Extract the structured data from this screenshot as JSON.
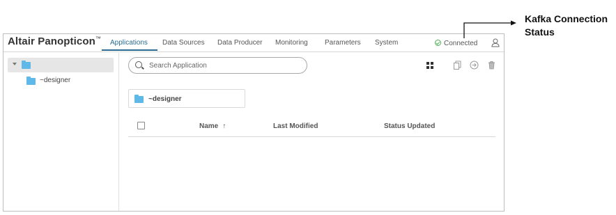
{
  "brand": {
    "name": "Altair Panopticon",
    "trademark": "™"
  },
  "nav": {
    "tabs": [
      {
        "label": "Applications",
        "active": true
      },
      {
        "label": "Data Sources"
      },
      {
        "label": "Data Producer"
      },
      {
        "label": "Monitoring"
      },
      {
        "label": "Parameters"
      },
      {
        "label": "System"
      }
    ],
    "status": "Connected"
  },
  "sidebar": {
    "child_label": "~designer"
  },
  "search": {
    "placeholder": "Search Application"
  },
  "folder_card": {
    "label": "~designer"
  },
  "table": {
    "columns": [
      "Name",
      "Last Modified",
      "Status Updated"
    ],
    "sort_indicator": "↑"
  },
  "annotation": {
    "line1": "Kafka Connection",
    "line2": "Status"
  },
  "colors": {
    "accent": "#2a6b8f",
    "folder": "#5fb9e8",
    "status_ok": "#4caf50"
  },
  "icons": [
    "user-icon",
    "grid-view-icon",
    "copy-icon",
    "export-icon",
    "trash-icon",
    "search-icon",
    "folder-icon",
    "check-circle-icon"
  ]
}
